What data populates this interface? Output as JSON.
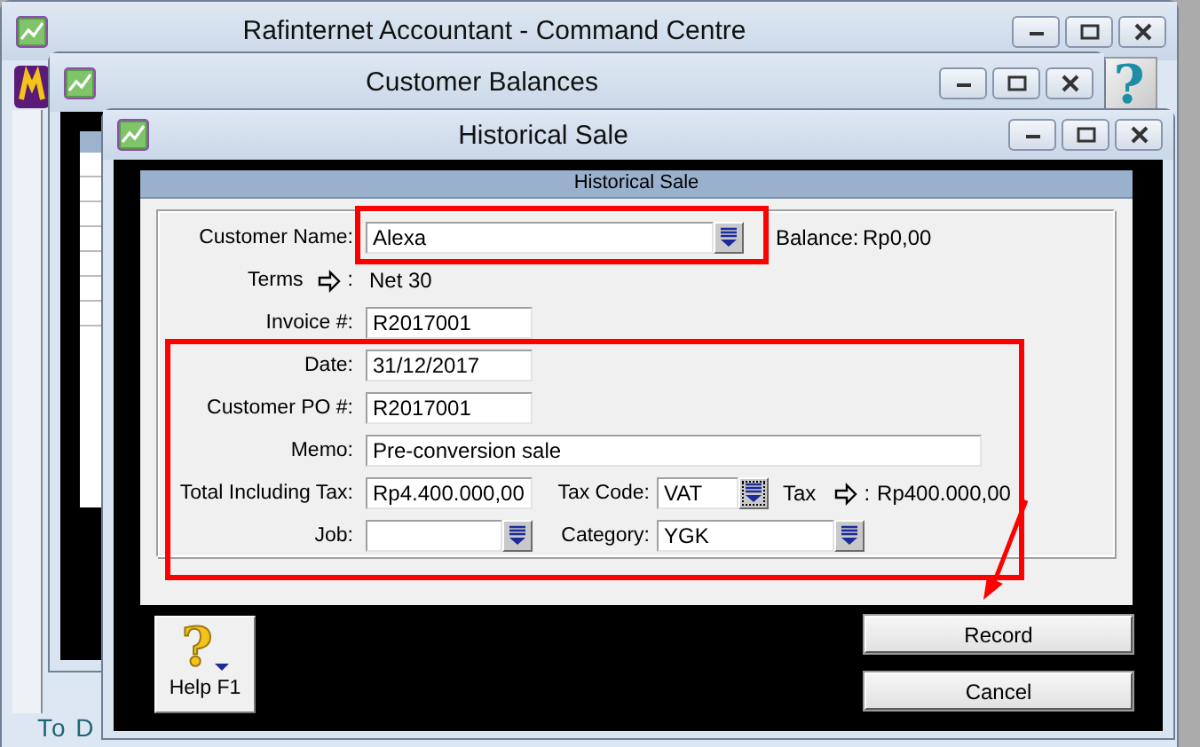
{
  "command_centre": {
    "title": "Rafinternet Accountant - Command Centre",
    "help_glyph": "?",
    "footer_text": "To D"
  },
  "customer_balances": {
    "title": "Customer Balances"
  },
  "historical_sale": {
    "title": "Historical Sale",
    "header": "Historical Sale",
    "customer": {
      "label": "Customer Name:",
      "kind": "dropdown",
      "value": "Alexa"
    },
    "balance": {
      "label": "Balance:",
      "value": "Rp0,00"
    },
    "terms": {
      "label": "Terms",
      "separator": ":",
      "value": "Net 30"
    },
    "invoice": {
      "label": "Invoice #:",
      "value": "R2017001"
    },
    "date": {
      "label": "Date:",
      "value": "31/12/2017"
    },
    "customer_po": {
      "label": "Customer PO #:",
      "value": "R2017001"
    },
    "memo": {
      "label": "Memo:",
      "value": "Pre-conversion sale"
    },
    "total": {
      "label": "Total Including Tax:",
      "value": "Rp4.400.000,00"
    },
    "tax_code": {
      "label": "Tax Code:",
      "kind": "dropdown",
      "value": "VAT",
      "focused": true
    },
    "tax": {
      "label": "Tax",
      "separator": ":",
      "value": "Rp400.000,00"
    },
    "job": {
      "label": "Job:",
      "kind": "dropdown"
    },
    "category": {
      "label": "Category:",
      "kind": "dropdown",
      "value": "YGK"
    },
    "help_button": {
      "glyph": "?",
      "label": "Help F1"
    },
    "buttons": [
      {
        "label": "Record"
      },
      {
        "label": "Cancel"
      }
    ]
  },
  "annotations": [
    {
      "kind": "box"
    },
    {
      "kind": "box"
    },
    {
      "kind": "arrow"
    }
  ]
}
